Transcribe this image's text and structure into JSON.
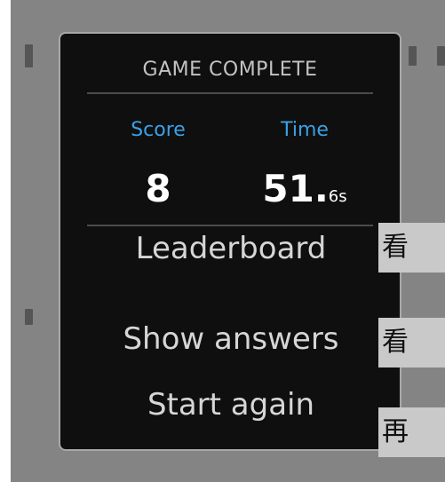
{
  "panel": {
    "title": "GAME COMPLETE",
    "score_label": "Score",
    "time_label": "Time",
    "score_value": "8",
    "time_whole": "51.",
    "time_fraction": "6s"
  },
  "menu": {
    "leaderboard": "Leaderboard",
    "show_answers": "Show answers",
    "start_again": "Start again"
  },
  "side_tabs": [
    {
      "label": "看"
    },
    {
      "label": "看"
    },
    {
      "label": "再"
    }
  ],
  "colors": {
    "accent": "#3aa0e8",
    "panel_bg": "#0f0f0f",
    "backdrop": "#848484",
    "tab_bg": "#c9c9c9"
  }
}
